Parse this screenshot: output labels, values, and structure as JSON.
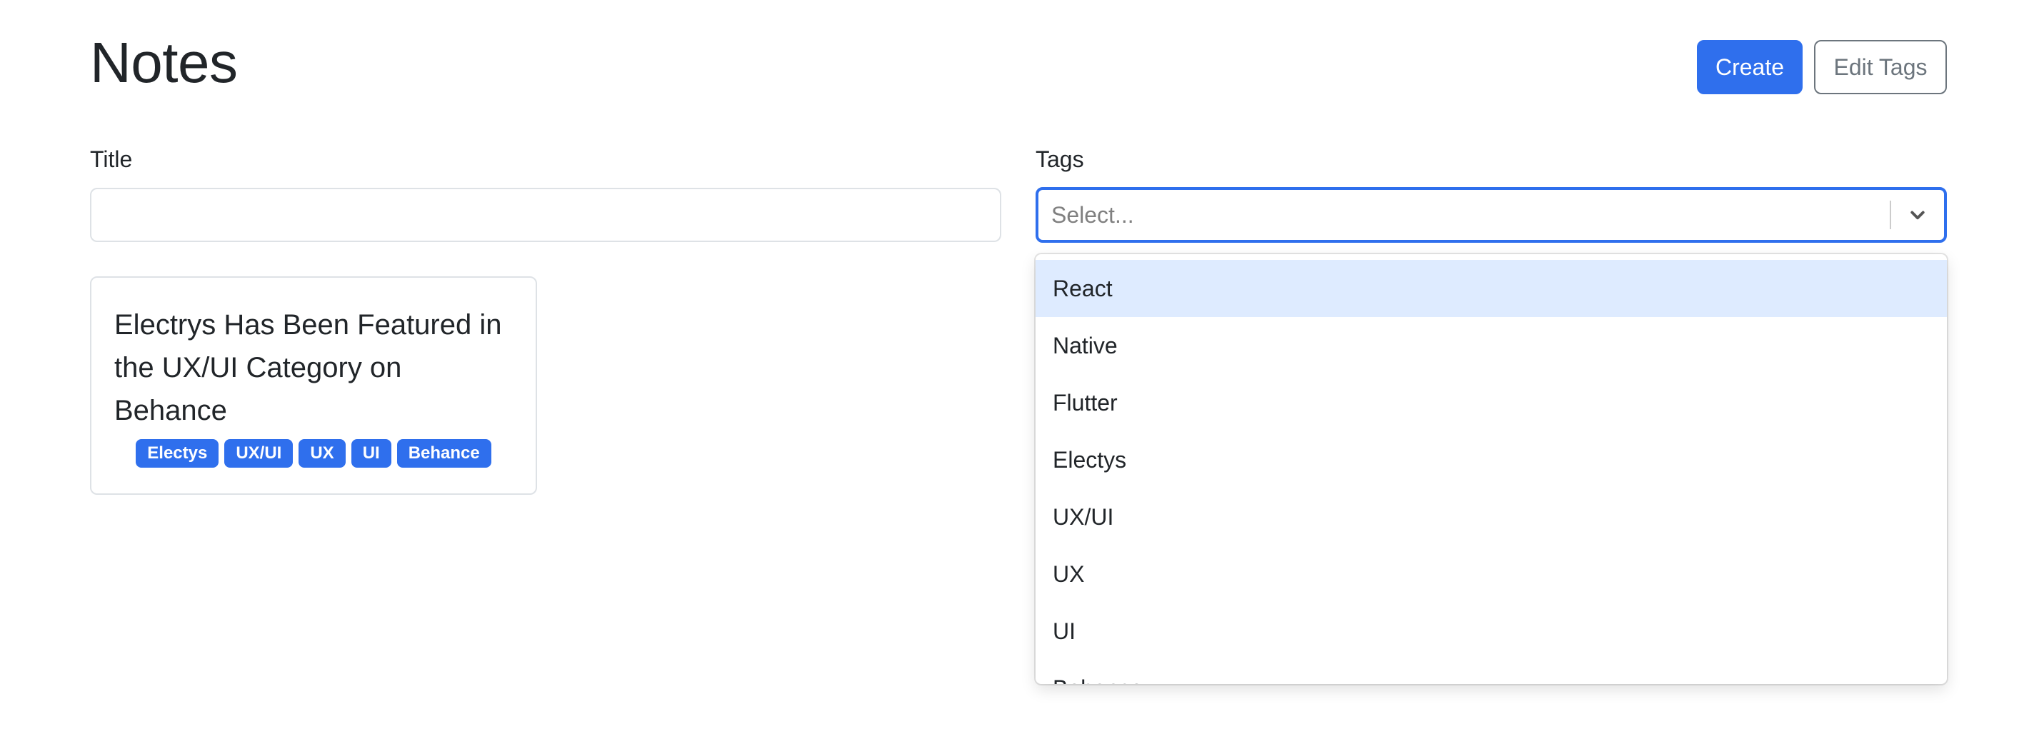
{
  "header": {
    "title": "Notes",
    "create_label": "Create",
    "edit_tags_label": "Edit Tags"
  },
  "filters": {
    "title_label": "Title",
    "title_value": "",
    "tags_label": "Tags",
    "tags_placeholder": "Select..."
  },
  "dropdown": {
    "options": [
      "React",
      "Native",
      "Flutter",
      "Electys",
      "UX/UI",
      "UX",
      "UI",
      "Behance"
    ],
    "focused_index": 0
  },
  "notes": [
    {
      "title": "Electrys Has Been Featured in the UX/UI Category on Behance",
      "tags": [
        "Electys",
        "UX/UI",
        "UX",
        "UI",
        "Behance"
      ]
    }
  ],
  "colors": {
    "primary": "#2f6fed",
    "secondary": "#6c757d",
    "option_focus": "#deebff"
  }
}
